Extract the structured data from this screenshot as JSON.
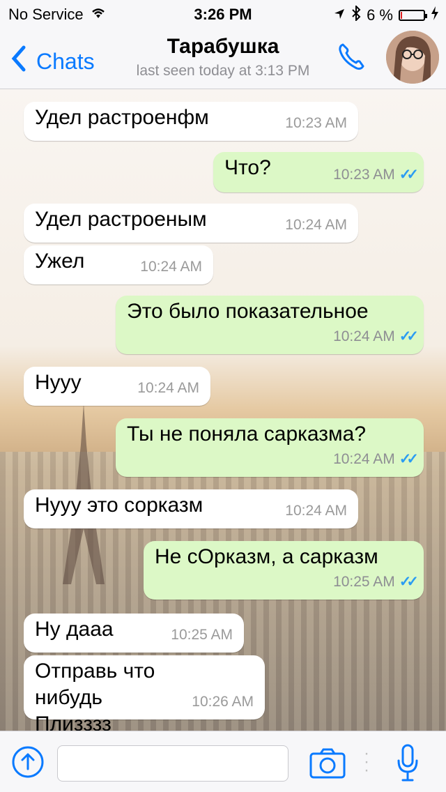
{
  "status": {
    "carrier": "No Service",
    "time": "3:26 PM",
    "battery_text": "6 %",
    "battery_level": 0.06
  },
  "nav": {
    "back_label": "Chats",
    "contact_name": "Тарабушка",
    "last_seen": "last seen today at 3:13 PM"
  },
  "messages": [
    {
      "text": "Удел растроенфм",
      "time": "10:23 AM",
      "dir": "in"
    },
    {
      "text": "Что?",
      "time": "10:23 AM",
      "dir": "out"
    },
    {
      "text": "Удел растроеным",
      "time": "10:24 AM",
      "dir": "in"
    },
    {
      "text": "Ужел",
      "time": "10:24 AM",
      "dir": "in"
    },
    {
      "text": "Это было показательное",
      "time": "10:24 AM",
      "dir": "out"
    },
    {
      "text": "Нууу",
      "time": "10:24 AM",
      "dir": "in"
    },
    {
      "text": "Ты не поняла сарказма?",
      "time": "10:24 AM",
      "dir": "out"
    },
    {
      "text": "Нууу это сорказм",
      "time": "10:24 AM",
      "dir": "in"
    },
    {
      "text": "Не сОрказм, а сарказм",
      "time": "10:25 AM",
      "dir": "out"
    },
    {
      "text": "Ну дааа",
      "time": "10:25 AM",
      "dir": "in"
    },
    {
      "text": "Отправь что нибудь Плизззз",
      "time": "10:26 AM",
      "dir": "in"
    }
  ],
  "colors": {
    "accent": "#0a7aff",
    "outgoing_bubble": "#dcf8c6",
    "incoming_bubble": "#ffffff",
    "read_ticks": "#2b9cf2"
  },
  "icons": {
    "share": "upload-arrow-icon",
    "camera": "camera-icon",
    "mic": "microphone-icon",
    "call": "phone-icon"
  }
}
